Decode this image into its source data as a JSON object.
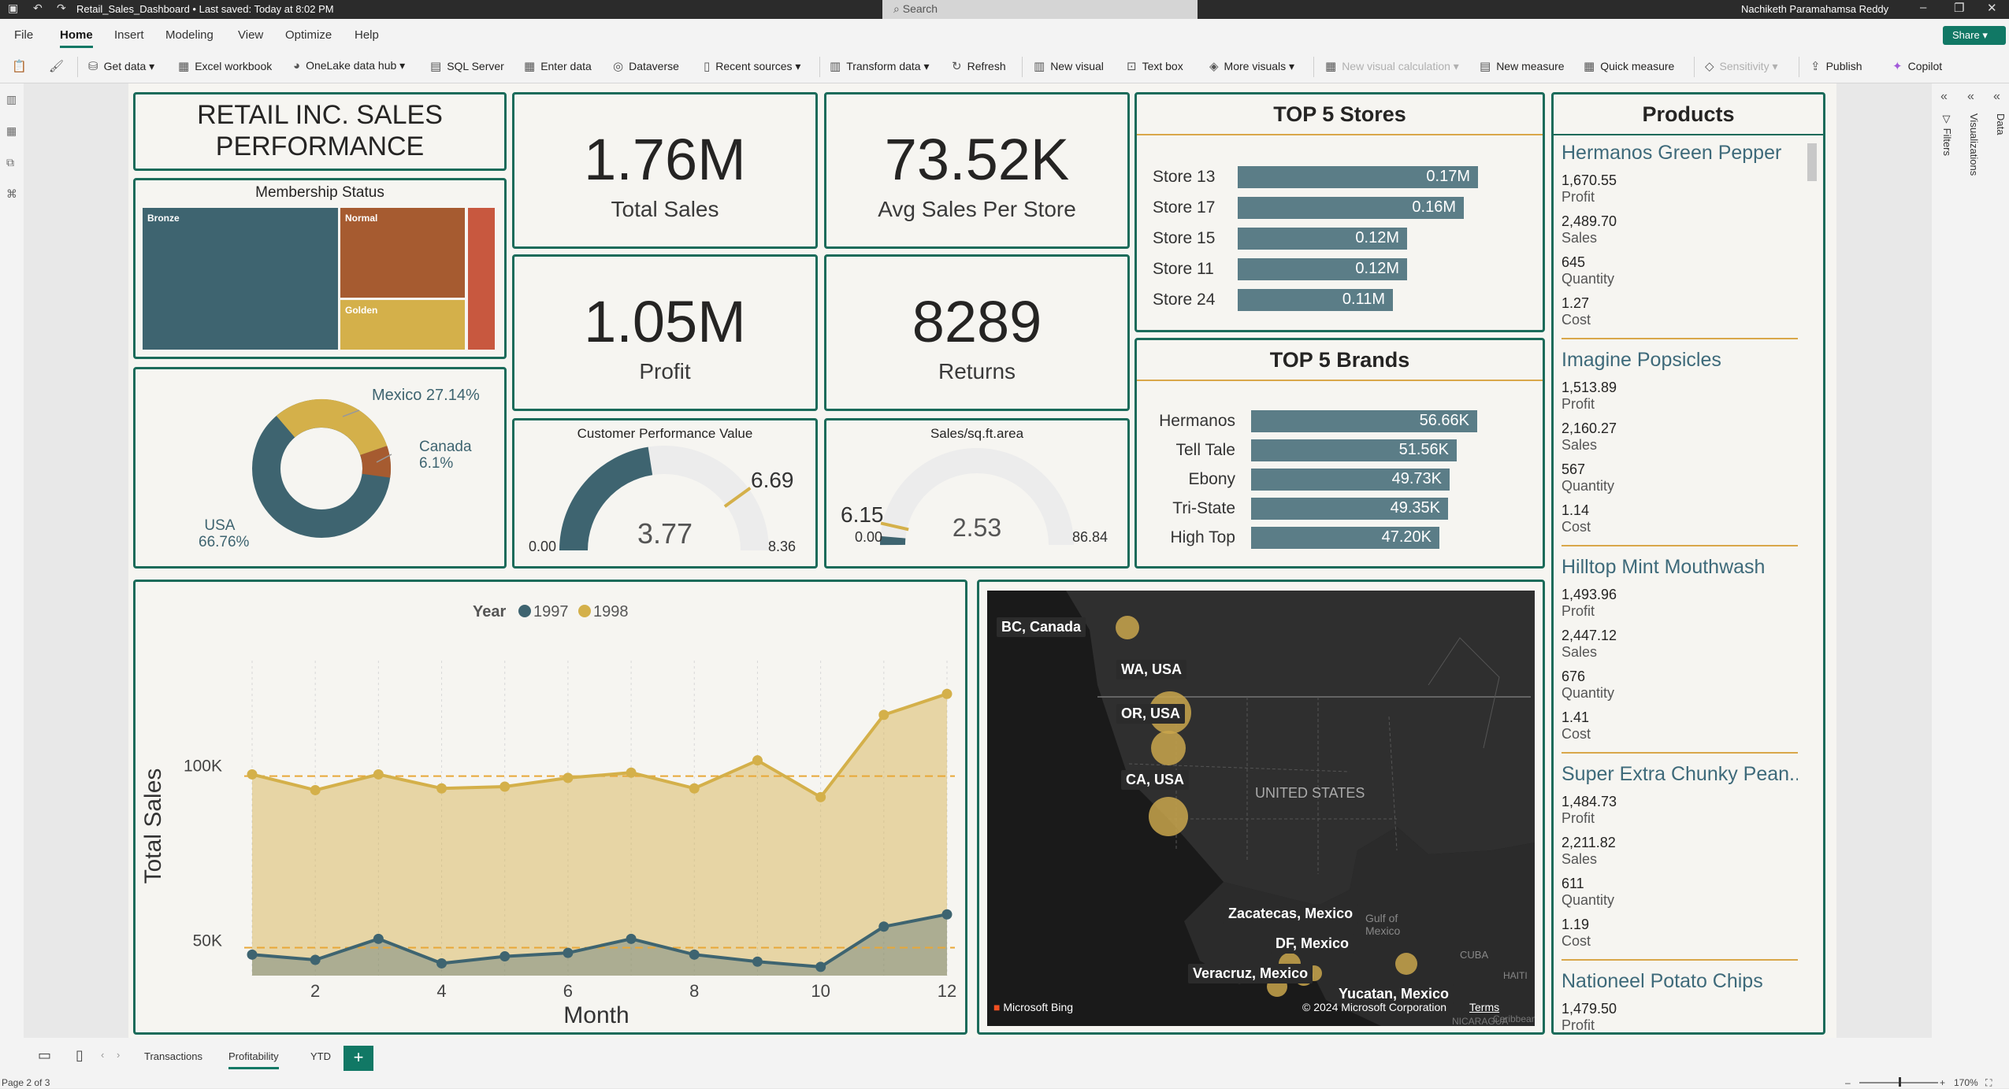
{
  "titlebar": {
    "file_title": "Retail_Sales_Dashboard • Last saved: Today at 8:02 PM",
    "search_placeholder": "Search",
    "user": "Nachiketh Paramahamsa Reddy"
  },
  "menu": {
    "file": "File",
    "home": "Home",
    "insert": "Insert",
    "modeling": "Modeling",
    "view": "View",
    "optimize": "Optimize",
    "help": "Help",
    "share": "Share"
  },
  "ribbon": {
    "get_data": "Get data",
    "excel": "Excel workbook",
    "onelake": "OneLake data hub",
    "sql": "SQL Server",
    "enter_data": "Enter data",
    "dataverse": "Dataverse",
    "recent": "Recent sources",
    "transform": "Transform data",
    "refresh": "Refresh",
    "new_visual": "New visual",
    "text_box": "Text box",
    "more_visuals": "More visuals",
    "new_visual_calc": "New visual calculation",
    "new_measure": "New measure",
    "quick_measure": "Quick measure",
    "sensitivity": "Sensitivity",
    "publish": "Publish",
    "copilot": "Copilot"
  },
  "panes": {
    "filters": "Filters",
    "visualizations": "Visualizations",
    "data": "Data"
  },
  "report": {
    "title_line1": "RETAIL INC. SALES",
    "title_line2": "PERFORMANCE",
    "kpis": {
      "total_sales": {
        "value": "1.76M",
        "label": "Total Sales"
      },
      "avg_sales": {
        "value": "73.52K",
        "label": "Avg Sales Per Store"
      },
      "profit": {
        "value": "1.05M",
        "label": "Profit"
      },
      "returns": {
        "value": "8289",
        "label": "Returns"
      }
    },
    "membership": {
      "title": "Membership Status",
      "bronze": "Bronze",
      "normal": "Normal",
      "golden": "Golden"
    },
    "donut": {
      "mexico": "Mexico 27.14%",
      "canada": "Canada",
      "canada_pct": "6.1%",
      "usa": "USA",
      "usa_pct": "66.76%"
    },
    "gauge1": {
      "title": "Customer Performance Value",
      "value": "3.77",
      "target": "6.69",
      "min": "0.00",
      "max": "8.36"
    },
    "gauge2": {
      "title": "Sales/sq.ft.area",
      "value": "2.53",
      "target": "6.15",
      "min": "0.00",
      "max": "86.84"
    },
    "stores": {
      "title": "TOP 5 Stores",
      "items": [
        {
          "name": "Store 13",
          "value": "0.17M"
        },
        {
          "name": "Store 17",
          "value": "0.16M"
        },
        {
          "name": "Store 15",
          "value": "0.12M"
        },
        {
          "name": "Store 11",
          "value": "0.12M"
        },
        {
          "name": "Store 24",
          "value": "0.11M"
        }
      ]
    },
    "brands": {
      "title": "TOP 5 Brands",
      "items": [
        {
          "name": "Hermanos",
          "value": "56.66K"
        },
        {
          "name": "Tell Tale",
          "value": "51.56K"
        },
        {
          "name": "Ebony",
          "value": "49.73K"
        },
        {
          "name": "Tri-State",
          "value": "49.35K"
        },
        {
          "name": "High Top",
          "value": "47.20K"
        }
      ]
    },
    "products": {
      "title": "Products",
      "items": [
        {
          "name": "Hermanos Green Pepper",
          "profit": "1,670.55",
          "sales": "2,489.70",
          "quantity": "645",
          "cost": "1.27"
        },
        {
          "name": "Imagine Popsicles",
          "profit": "1,513.89",
          "sales": "2,160.27",
          "quantity": "567",
          "cost": "1.14"
        },
        {
          "name": "Hilltop Mint Mouthwash",
          "profit": "1,493.96",
          "sales": "2,447.12",
          "quantity": "676",
          "cost": "1.41"
        },
        {
          "name": "Super Extra Chunky Pean...",
          "profit": "1,484.73",
          "sales": "2,211.82",
          "quantity": "611",
          "cost": "1.19"
        },
        {
          "name": "Nationeel Potato Chips",
          "profit": "1,479.50"
        }
      ],
      "labels": {
        "profit": "Profit",
        "sales": "Sales",
        "quantity": "Quantity",
        "cost": "Cost"
      }
    },
    "map": {
      "labels": [
        "BC, Canada",
        "WA, USA",
        "OR, USA",
        "CA, USA",
        "Zacatecas, Mexico",
        "DF, Mexico",
        "Veracruz, Mexico",
        "Yucatan, Mexico"
      ],
      "country": "UNITED STATES",
      "gulf": "Gulf of Mexico",
      "cuba": "CUBA",
      "haiti": "HAITI",
      "nicaragua": "NICARAGUA",
      "caribbean": "Caribbean",
      "bing": "Microsoft Bing",
      "copyright": "© 2024 Microsoft Corporation",
      "terms": "Terms"
    }
  },
  "chart_data": {
    "type": "area",
    "legend_title": "Year",
    "xlabel": "Month",
    "ylabel": "Total Sales",
    "x": [
      1,
      2,
      3,
      4,
      5,
      6,
      7,
      8,
      9,
      10,
      11,
      12
    ],
    "x_ticks": [
      "2",
      "4",
      "6",
      "8",
      "10",
      "12"
    ],
    "y_ticks": [
      "50K",
      "100K"
    ],
    "ylim": [
      40000,
      130000
    ],
    "reference_lines": [
      48000,
      97000
    ],
    "series": [
      {
        "name": "1997",
        "color": "#3e6470",
        "values": [
          46000,
          44500,
          50500,
          43500,
          45500,
          46500,
          50500,
          46000,
          44000,
          42500,
          54000,
          57500
        ]
      },
      {
        "name": "1998",
        "color": "#d4b04a",
        "values": [
          97500,
          93000,
          97500,
          93500,
          94000,
          96500,
          98000,
          93500,
          101500,
          91000,
          114500,
          120500
        ]
      }
    ],
    "legend": "top-center"
  },
  "tabs": [
    "Transactions",
    "Profitability",
    "YTD"
  ],
  "status": {
    "page": "Page 2 of 3",
    "zoom": "170%"
  }
}
